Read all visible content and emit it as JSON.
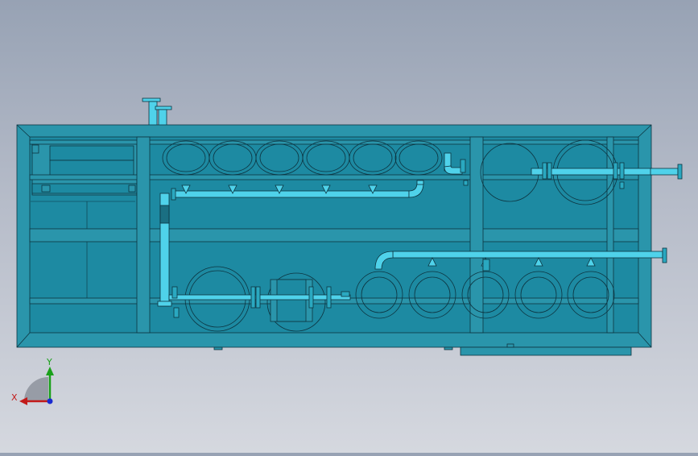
{
  "view": {
    "type": "cad-assembly-top-view",
    "colors": {
      "frame": "#2a95ab",
      "frame_dark": "#1a6f82",
      "panel": "#1d8aa2",
      "pipe": "#4fd2ea",
      "pipe_shadow": "#2aa8c0",
      "edge": "#0d3440",
      "background_top": "#97a2b4",
      "background_bottom": "#d5d8df"
    }
  },
  "triad": {
    "x_label": "X",
    "y_label": "Y",
    "x_color": "#c21a1a",
    "y_color": "#1aa01a",
    "z_color": "#1a2ad0"
  }
}
